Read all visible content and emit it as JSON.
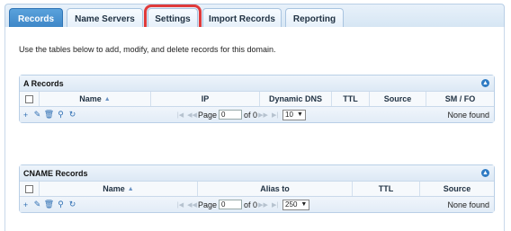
{
  "tabs": [
    {
      "label": "Records",
      "active": true
    },
    {
      "label": "Name Servers",
      "active": false
    },
    {
      "label": "Settings",
      "active": false,
      "highlighted": true
    },
    {
      "label": "Import Records",
      "active": false
    },
    {
      "label": "Reporting",
      "active": false
    }
  ],
  "intro_text": "Use the tables below to add, modify, and delete records for this domain.",
  "a_records": {
    "title": "A Records",
    "columns": [
      "Name",
      "IP",
      "Dynamic DNS",
      "TTL",
      "Source",
      "SM / FO"
    ],
    "pager": {
      "page_label": "Page",
      "page_value": "0",
      "of_label": "of 0",
      "per_page": "10",
      "status": "None found"
    }
  },
  "cname_records": {
    "title": "CNAME Records",
    "columns": [
      "Name",
      "Alias to",
      "TTL",
      "Source"
    ],
    "pager": {
      "page_label": "Page",
      "page_value": "0",
      "of_label": "of 0",
      "per_page": "250",
      "status": "None found"
    }
  },
  "icons": {
    "add": "plus-icon",
    "edit": "pencil-icon",
    "delete": "trash-icon",
    "search": "search-icon",
    "refresh": "refresh-icon",
    "collapse": "collapse-icon"
  },
  "colors": {
    "active_tab": "#3a83c5",
    "highlight": "#e03b3b",
    "icon": "#2f6fb3"
  }
}
